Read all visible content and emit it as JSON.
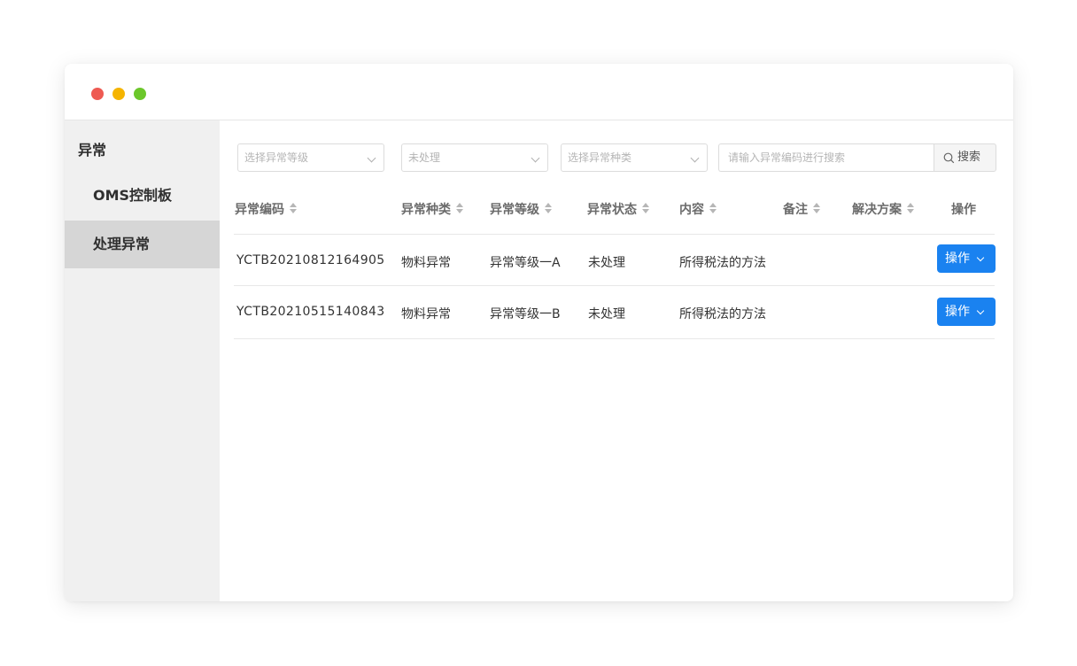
{
  "window": {
    "controls": {
      "close_color": "#ee5a52",
      "minimize_color": "#f5b400",
      "maximize_color": "#6cc72b"
    }
  },
  "sidebar": {
    "group_label": "异常",
    "items": [
      {
        "label": "OMS控制板",
        "active": false
      },
      {
        "label": "处理异常",
        "active": true
      }
    ]
  },
  "filters": {
    "level_placeholder": "选择异常等级",
    "status_value": "未处理",
    "type_placeholder": "选择异常种类",
    "search_placeholder": "请输入异常编码进行搜索",
    "search_button": "搜索"
  },
  "table": {
    "headers": [
      "异常编码",
      "异常种类",
      "异常等级",
      "异常状态",
      "内容",
      "备注",
      "解决方案",
      "操作"
    ],
    "rows": [
      {
        "code": "YCTB20210812164905",
        "type": "物料异常",
        "level": "异常等级一A",
        "status": "未处理",
        "content": "所得税法的方法",
        "remark": "",
        "solution": "",
        "action": "操作"
      },
      {
        "code": "YCTB20210515140843",
        "type": "物料异常",
        "level": "异常等级一B",
        "status": "未处理",
        "content": "所得税法的方法",
        "remark": "",
        "solution": "",
        "action": "操作"
      }
    ]
  },
  "colors": {
    "primary": "#1a82f0",
    "sidebar_bg": "#f0f0f0",
    "sidebar_active": "#d6d6d6"
  }
}
